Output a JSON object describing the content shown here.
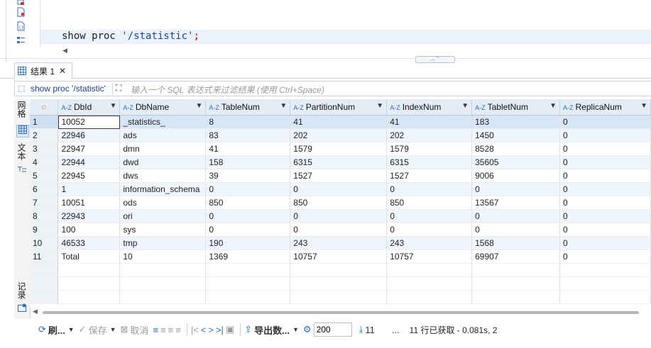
{
  "editor": {
    "code_keyword": "show proc ",
    "code_string": "'/statistic'",
    "code_semicolon": ";"
  },
  "result_tab": {
    "label": "结果 1"
  },
  "filter": {
    "query_label": "show proc '/statistic'",
    "placeholder": "输入一个 SQL 表达式来过滤结果 (使用 Ctrl+Space)"
  },
  "side_panel": {
    "grid_label": "网格",
    "text_label": "文本",
    "record_label": "记录"
  },
  "grid": {
    "columns": [
      "DbId",
      "DbName",
      "TableNum",
      "PartitionNum",
      "IndexNum",
      "TabletNum",
      "ReplicaNum"
    ],
    "rows": [
      {
        "n": "1",
        "c": [
          "10052",
          "_statistics_",
          "8",
          "41",
          "41",
          "183",
          "0"
        ]
      },
      {
        "n": "2",
        "c": [
          "22946",
          "ads",
          "83",
          "202",
          "202",
          "1450",
          "0"
        ]
      },
      {
        "n": "3",
        "c": [
          "22947",
          "dmn",
          "41",
          "1579",
          "1579",
          "8528",
          "0"
        ]
      },
      {
        "n": "4",
        "c": [
          "22944",
          "dwd",
          "158",
          "6315",
          "6315",
          "35605",
          "0"
        ]
      },
      {
        "n": "5",
        "c": [
          "22945",
          "dws",
          "39",
          "1527",
          "1527",
          "9006",
          "0"
        ]
      },
      {
        "n": "6",
        "c": [
          "1",
          "information_schema",
          "0",
          "0",
          "0",
          "0",
          "0"
        ]
      },
      {
        "n": "7",
        "c": [
          "10051",
          "ods",
          "850",
          "850",
          "850",
          "13567",
          "0"
        ]
      },
      {
        "n": "8",
        "c": [
          "22943",
          "ori",
          "0",
          "0",
          "0",
          "0",
          "0"
        ]
      },
      {
        "n": "9",
        "c": [
          "100",
          "sys",
          "0",
          "0",
          "0",
          "0",
          "0"
        ]
      },
      {
        "n": "10",
        "c": [
          "46533",
          "tmp",
          "190",
          "243",
          "243",
          "1568",
          "0"
        ]
      },
      {
        "n": "11",
        "c": [
          "Total",
          "10",
          "1369",
          "10757",
          "10757",
          "69907",
          "0"
        ]
      }
    ]
  },
  "toolbar": {
    "refresh_label": "刷...",
    "save_label": "保存",
    "cancel_label": "取消",
    "export_label": "导出数...",
    "fetch_size": "200",
    "row_count": "11",
    "more": "...",
    "status": "11 行已获取 - 0.081s, 2"
  }
}
